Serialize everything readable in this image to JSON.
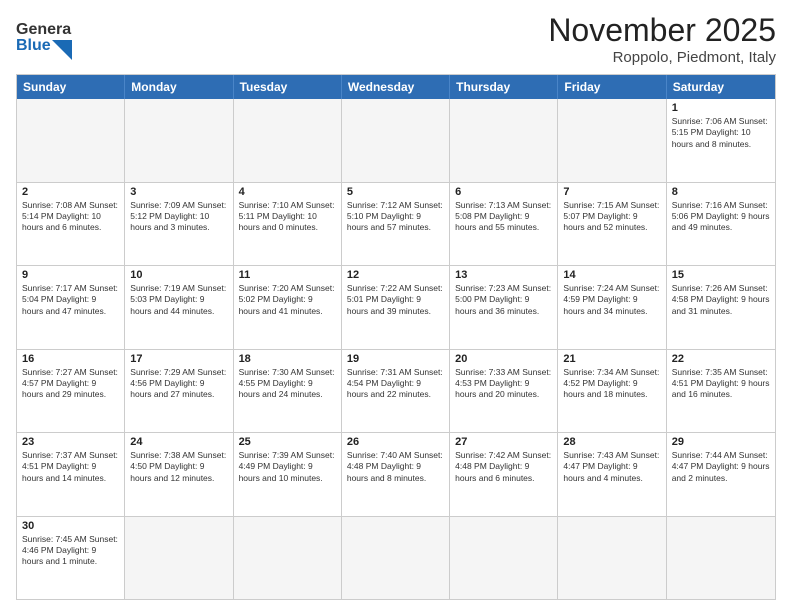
{
  "header": {
    "logo_general": "General",
    "logo_blue": "Blue",
    "month_title": "November 2025",
    "location": "Roppolo, Piedmont, Italy"
  },
  "calendar": {
    "days_of_week": [
      "Sunday",
      "Monday",
      "Tuesday",
      "Wednesday",
      "Thursday",
      "Friday",
      "Saturday"
    ],
    "weeks": [
      [
        {
          "day": "",
          "info": ""
        },
        {
          "day": "",
          "info": ""
        },
        {
          "day": "",
          "info": ""
        },
        {
          "day": "",
          "info": ""
        },
        {
          "day": "",
          "info": ""
        },
        {
          "day": "",
          "info": ""
        },
        {
          "day": "1",
          "info": "Sunrise: 7:06 AM\nSunset: 5:15 PM\nDaylight: 10 hours and 8 minutes."
        }
      ],
      [
        {
          "day": "2",
          "info": "Sunrise: 7:08 AM\nSunset: 5:14 PM\nDaylight: 10 hours and 6 minutes."
        },
        {
          "day": "3",
          "info": "Sunrise: 7:09 AM\nSunset: 5:12 PM\nDaylight: 10 hours and 3 minutes."
        },
        {
          "day": "4",
          "info": "Sunrise: 7:10 AM\nSunset: 5:11 PM\nDaylight: 10 hours and 0 minutes."
        },
        {
          "day": "5",
          "info": "Sunrise: 7:12 AM\nSunset: 5:10 PM\nDaylight: 9 hours and 57 minutes."
        },
        {
          "day": "6",
          "info": "Sunrise: 7:13 AM\nSunset: 5:08 PM\nDaylight: 9 hours and 55 minutes."
        },
        {
          "day": "7",
          "info": "Sunrise: 7:15 AM\nSunset: 5:07 PM\nDaylight: 9 hours and 52 minutes."
        },
        {
          "day": "8",
          "info": "Sunrise: 7:16 AM\nSunset: 5:06 PM\nDaylight: 9 hours and 49 minutes."
        }
      ],
      [
        {
          "day": "9",
          "info": "Sunrise: 7:17 AM\nSunset: 5:04 PM\nDaylight: 9 hours and 47 minutes."
        },
        {
          "day": "10",
          "info": "Sunrise: 7:19 AM\nSunset: 5:03 PM\nDaylight: 9 hours and 44 minutes."
        },
        {
          "day": "11",
          "info": "Sunrise: 7:20 AM\nSunset: 5:02 PM\nDaylight: 9 hours and 41 minutes."
        },
        {
          "day": "12",
          "info": "Sunrise: 7:22 AM\nSunset: 5:01 PM\nDaylight: 9 hours and 39 minutes."
        },
        {
          "day": "13",
          "info": "Sunrise: 7:23 AM\nSunset: 5:00 PM\nDaylight: 9 hours and 36 minutes."
        },
        {
          "day": "14",
          "info": "Sunrise: 7:24 AM\nSunset: 4:59 PM\nDaylight: 9 hours and 34 minutes."
        },
        {
          "day": "15",
          "info": "Sunrise: 7:26 AM\nSunset: 4:58 PM\nDaylight: 9 hours and 31 minutes."
        }
      ],
      [
        {
          "day": "16",
          "info": "Sunrise: 7:27 AM\nSunset: 4:57 PM\nDaylight: 9 hours and 29 minutes."
        },
        {
          "day": "17",
          "info": "Sunrise: 7:29 AM\nSunset: 4:56 PM\nDaylight: 9 hours and 27 minutes."
        },
        {
          "day": "18",
          "info": "Sunrise: 7:30 AM\nSunset: 4:55 PM\nDaylight: 9 hours and 24 minutes."
        },
        {
          "day": "19",
          "info": "Sunrise: 7:31 AM\nSunset: 4:54 PM\nDaylight: 9 hours and 22 minutes."
        },
        {
          "day": "20",
          "info": "Sunrise: 7:33 AM\nSunset: 4:53 PM\nDaylight: 9 hours and 20 minutes."
        },
        {
          "day": "21",
          "info": "Sunrise: 7:34 AM\nSunset: 4:52 PM\nDaylight: 9 hours and 18 minutes."
        },
        {
          "day": "22",
          "info": "Sunrise: 7:35 AM\nSunset: 4:51 PM\nDaylight: 9 hours and 16 minutes."
        }
      ],
      [
        {
          "day": "23",
          "info": "Sunrise: 7:37 AM\nSunset: 4:51 PM\nDaylight: 9 hours and 14 minutes."
        },
        {
          "day": "24",
          "info": "Sunrise: 7:38 AM\nSunset: 4:50 PM\nDaylight: 9 hours and 12 minutes."
        },
        {
          "day": "25",
          "info": "Sunrise: 7:39 AM\nSunset: 4:49 PM\nDaylight: 9 hours and 10 minutes."
        },
        {
          "day": "26",
          "info": "Sunrise: 7:40 AM\nSunset: 4:48 PM\nDaylight: 9 hours and 8 minutes."
        },
        {
          "day": "27",
          "info": "Sunrise: 7:42 AM\nSunset: 4:48 PM\nDaylight: 9 hours and 6 minutes."
        },
        {
          "day": "28",
          "info": "Sunrise: 7:43 AM\nSunset: 4:47 PM\nDaylight: 9 hours and 4 minutes."
        },
        {
          "day": "29",
          "info": "Sunrise: 7:44 AM\nSunset: 4:47 PM\nDaylight: 9 hours and 2 minutes."
        }
      ],
      [
        {
          "day": "30",
          "info": "Sunrise: 7:45 AM\nSunset: 4:46 PM\nDaylight: 9 hours and 1 minute."
        },
        {
          "day": "",
          "info": ""
        },
        {
          "day": "",
          "info": ""
        },
        {
          "day": "",
          "info": ""
        },
        {
          "day": "",
          "info": ""
        },
        {
          "day": "",
          "info": ""
        },
        {
          "day": "",
          "info": ""
        }
      ]
    ]
  }
}
